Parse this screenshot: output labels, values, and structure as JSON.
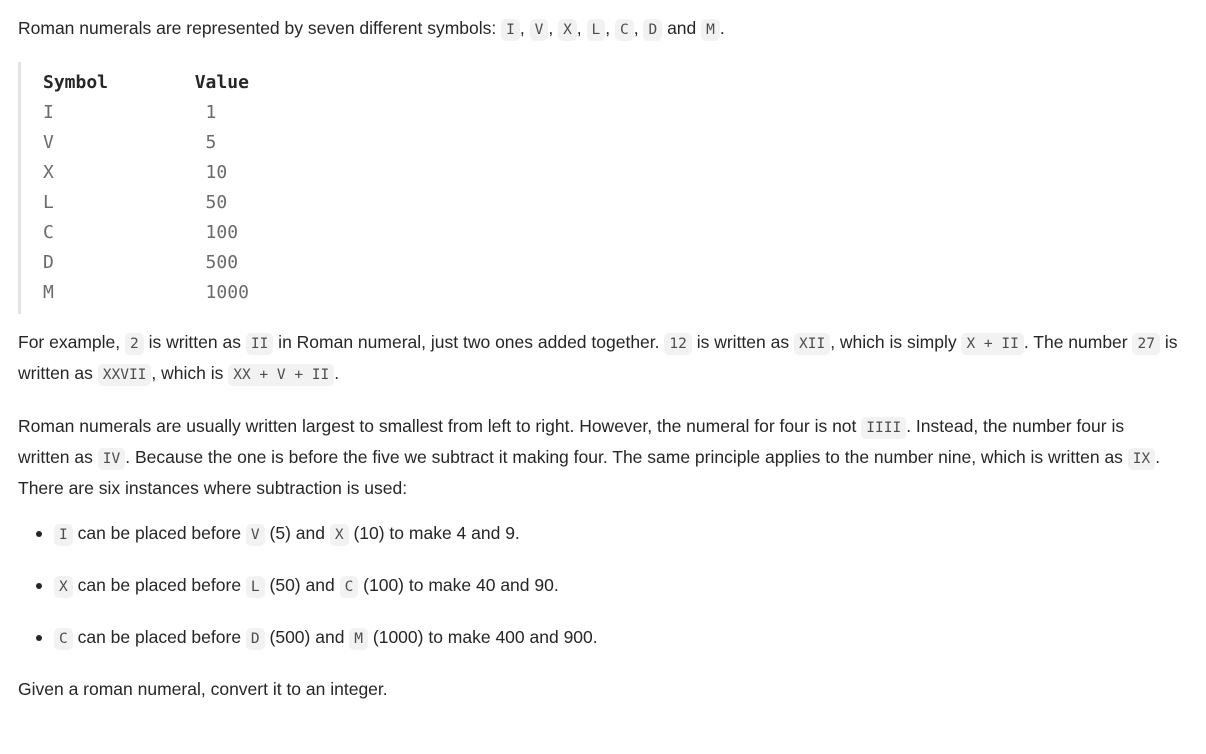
{
  "intro": {
    "prefix": "Roman numerals are represented by seven different symbols: ",
    "symbols": [
      "I",
      "V",
      "X",
      "L",
      "C",
      "D",
      "M"
    ],
    "sep": ", ",
    "conjunction": " and ",
    "suffix": "."
  },
  "symbol_table": {
    "columns": [
      "Symbol",
      "Value"
    ],
    "rows": [
      {
        "symbol": "I",
        "value": "1"
      },
      {
        "symbol": "V",
        "value": "5"
      },
      {
        "symbol": "X",
        "value": "10"
      },
      {
        "symbol": "L",
        "value": "50"
      },
      {
        "symbol": "C",
        "value": "100"
      },
      {
        "symbol": "D",
        "value": "500"
      },
      {
        "symbol": "M",
        "value": "1000"
      }
    ],
    "rendered_text": "Symbol        Value\nI              1\nV              5\nX              10\nL              50\nC              100\nD              500\nM              1000"
  },
  "paragraph_example": {
    "t1": "For example, ",
    "c1": "2",
    "t2": " is written as ",
    "c2": "II",
    "t3": " in Roman numeral, just two ones added together. ",
    "c3": "12",
    "t4": " is written as ",
    "c4": "XII",
    "t5": ", which is simply ",
    "c5": "X + II",
    "t6": ". The number ",
    "c6": "27",
    "t7": " is written as ",
    "c7": "XXVII",
    "t8": ", which is ",
    "c8": "XX + V + II",
    "t9": "."
  },
  "paragraph_rules": {
    "t1": "Roman numerals are usually written largest to smallest from left to right. However, the numeral for four is not ",
    "c1": "IIII",
    "t2": ". Instead, the number four is written as ",
    "c2": "IV",
    "t3": ". Because the one is before the five we subtract it making four. The same principle applies to the number nine, which is written as ",
    "c3": "IX",
    "t4": ". There are six instances where subtraction is used:"
  },
  "bullets": [
    {
      "code_a": "I",
      "mid1": " can be placed before ",
      "code_b": "V",
      "mid2": " (5) and ",
      "code_c": "X",
      "mid3": " (10) to make 4 and 9."
    },
    {
      "code_a": "X",
      "mid1": " can be placed before ",
      "code_b": "L",
      "mid2": " (50) and ",
      "code_c": "C",
      "mid3": " (100) to make 40 and 90."
    },
    {
      "code_a": "C",
      "mid1": " can be placed before ",
      "code_b": "D",
      "mid2": " (500) and ",
      "code_c": "M",
      "mid3": " (1000) to make 400 and 900."
    }
  ],
  "closing": {
    "text": "Given a roman numeral, convert it to an integer."
  }
}
